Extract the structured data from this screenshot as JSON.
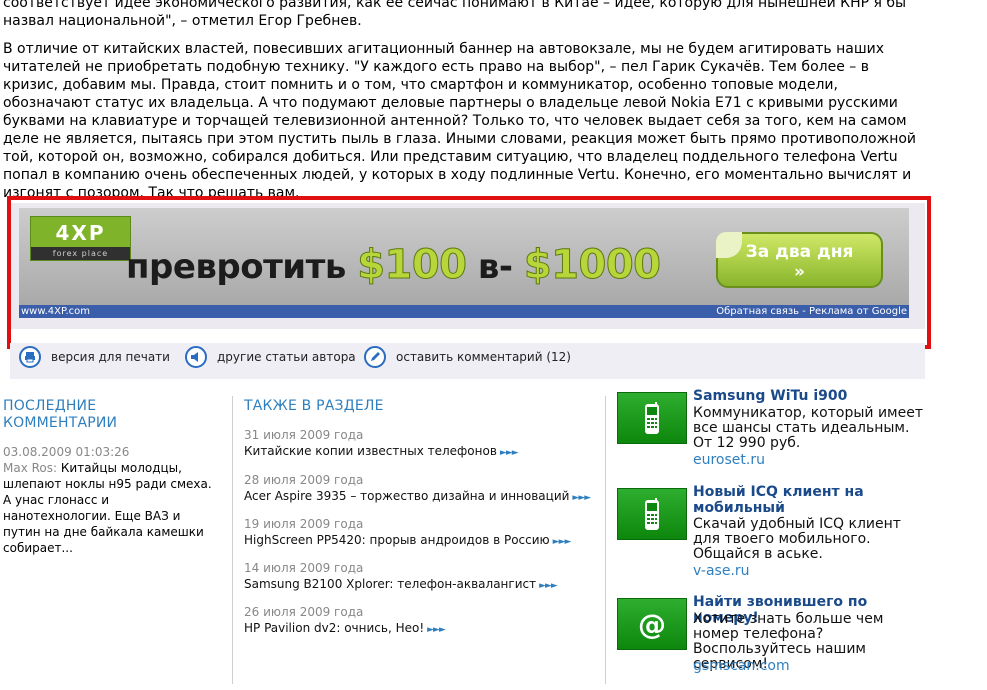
{
  "article": {
    "p1": "соответствует идее экономического развития, как ее сейчас понимают в Китае – идее, которую для нынешней КНР я бы назвал национальной\", – отметил Егор Гребнев.",
    "p2": "В отличие от китайских властей, повесивших агитационный баннер на автовокзале, мы не будем агитировать наших читателей не приобретать подобную технику. \"У каждого есть право на выбор\", – пел Гарик Сукачёв. Тем более – в кризис, добавим мы. Правда, стоит помнить и о том, что смартфон и коммуникатор, особенно топовые модели, обозначают статус их владельца. А что подумают деловые партнеры о владельце левой Nokia E71 с кривыми русскими буквами на клавиатуре и торчащей телевизионной антенной? Только то, что человек выдает себя за того, кем на самом деле не является, пытаясь при этом пустить пыль в глаза. Иными словами, реакция может быть прямо противоположной той, которой он, возможно, собирался добиться. Или представим ситуацию, что владелец поддельного телефона Vertu попал в компанию очень обеспеченных людей, у которых в ходу подлинные Vertu. Конечно, его моментально вычислят и изгонят с позором. Так что решать вам."
  },
  "banner": {
    "logo_main": "4XP",
    "logo_sub": "forex place",
    "headline_text": "превротить",
    "amount_from": "$100",
    "headline_mid": "в-",
    "amount_to": "$1000",
    "cta_label": "За два дня",
    "cta_arrows": "»",
    "footer_url": "www.4XP.com",
    "footer_links": "Обратная связь - Реклама от Google"
  },
  "tools": {
    "print_label": "версия для печати",
    "author_label": "другие статьи автора",
    "comment_label": "оставить комментарий (12)"
  },
  "comments": {
    "title": "ПОСЛЕДНИЕ КОММЕНТАРИИ",
    "date": "03.08.2009 01:03:26",
    "author": "Max Ros:",
    "text": "Китайцы молодцы, шлепают ноклы н95 ради смеха. А унас глонасс и нанотехнологии. Еще ВАЗ и путин на дне байкала камешки собирает..."
  },
  "section": {
    "title": "ТАКЖЕ В РАЗДЕЛЕ",
    "arrows": "►►►",
    "items": [
      {
        "date": "31 июля 2009 года",
        "title": "Китайские копии известных телефонов"
      },
      {
        "date": "28 июля 2009 года",
        "title": "Acer Aspire 3935 – торжество дизайна и инноваций"
      },
      {
        "date": "19 июля 2009 года",
        "title": "HighScreen PP5420: прорыв андроидов в Россию"
      },
      {
        "date": "14 июля 2009 года",
        "title": "Samsung B2100 Xplorer: телефон-аквалангист"
      },
      {
        "date": "26 июля 2009 года",
        "title": "HP Pavilion dv2: очнись, Нео!"
      }
    ]
  },
  "ads": [
    {
      "icon": "mobile-phone-icon",
      "title": "Samsung WiTu i900",
      "desc": "Коммуникатор, который имеет все шансы стать идеальным. От 12 990 руб.",
      "url": "euroset.ru"
    },
    {
      "icon": "mobile-phone-icon",
      "title": "Новый ICQ клиент на мобильный",
      "desc": "Скачай удобный ICQ клиент для твоего мобильного. Общайся в аське.",
      "url": "v-ase.ru"
    },
    {
      "icon": "at-sign-icon",
      "title": "Найти звонившего по номеру!",
      "desc": "Хотите знать больше чем номер телефона? Воспользуйтесь нашим сервисом!",
      "url": "gsmscan.com"
    }
  ],
  "colors": {
    "highlight": "#e01010",
    "link_blue": "#2f7fbf",
    "ad_green": "#1a9a1a",
    "ad_bar": "#3a5eaa"
  }
}
